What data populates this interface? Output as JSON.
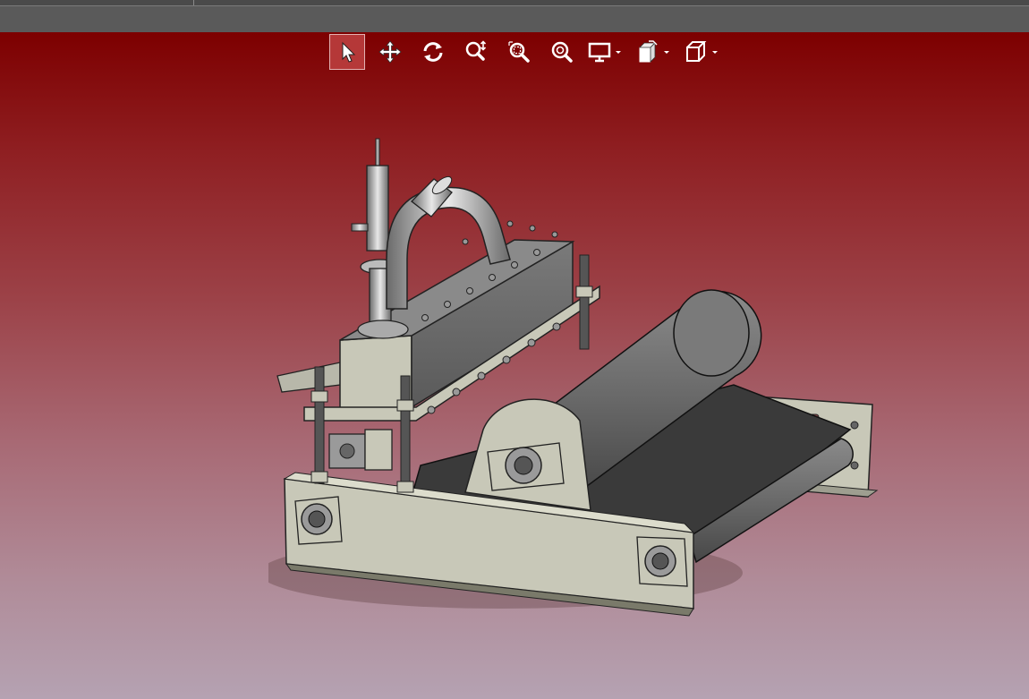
{
  "window": {
    "title": ""
  },
  "viewport": {
    "background_top": "#7d0000",
    "background_bottom": "#b5a2b2"
  },
  "toolbar": {
    "items": [
      {
        "icon": "select-arrow-icon",
        "active": true
      },
      {
        "icon": "pan-move-icon",
        "active": false
      },
      {
        "icon": "rotate-icon",
        "active": false
      },
      {
        "icon": "zoom-in-out-icon",
        "active": false
      },
      {
        "icon": "zoom-area-icon",
        "active": false
      },
      {
        "icon": "zoom-fit-icon",
        "active": false
      },
      {
        "icon": "display-monitor-icon",
        "dropdown": true
      },
      {
        "icon": "view-render-icon",
        "dropdown": true
      },
      {
        "icon": "view-cube-icon",
        "dropdown": true
      }
    ],
    "accent": "#b53838"
  },
  "model": {
    "label": "",
    "colors": {
      "frame": "#c8c8b8",
      "steel": "#6e6e6e",
      "dark": "#2a2a2a"
    }
  }
}
